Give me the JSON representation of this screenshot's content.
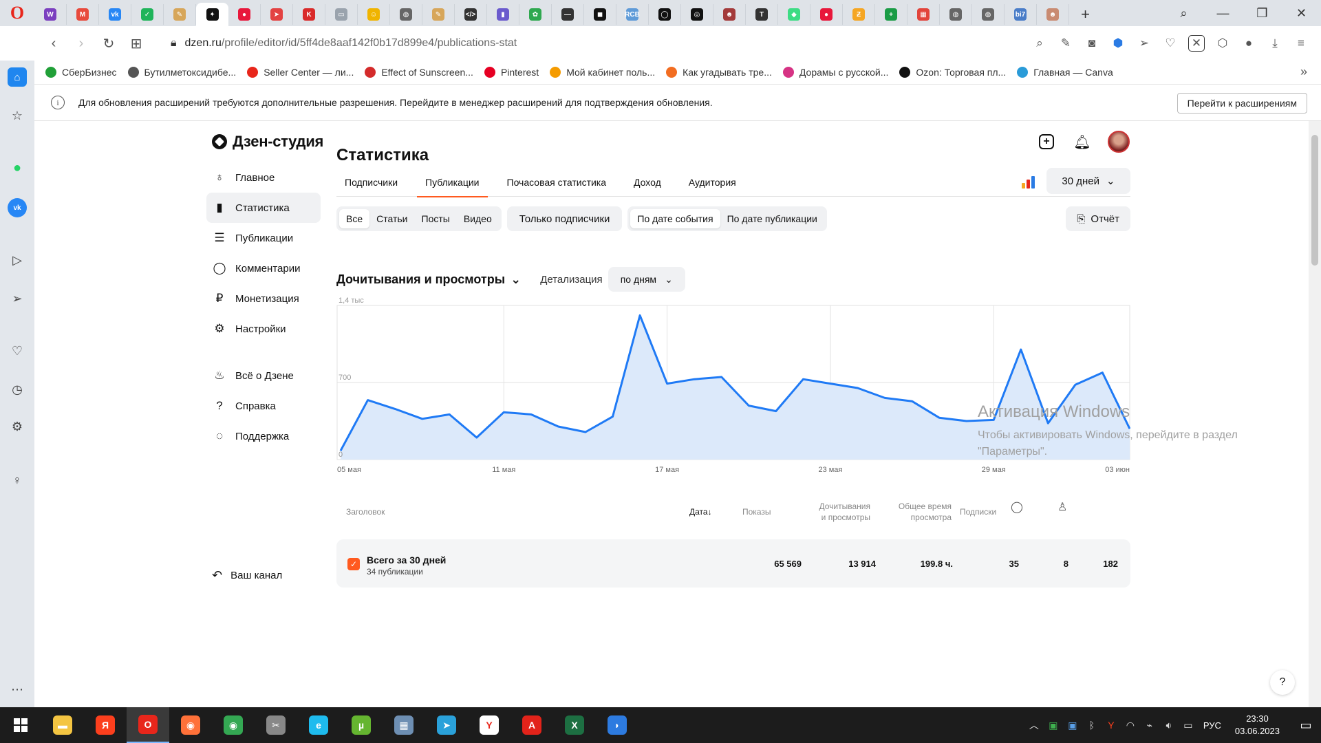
{
  "browser": {
    "logo": "O",
    "tabs": [
      {
        "icon": "word-favicon",
        "color": "#7b3fbf",
        "glyph": "W"
      },
      {
        "icon": "mail-favicon",
        "color": "#e84a3c",
        "glyph": "M"
      },
      {
        "icon": "vk-favicon",
        "color": "#2787f5",
        "glyph": "vk"
      },
      {
        "icon": "check-favicon",
        "color": "#1fb45a",
        "glyph": "✓"
      },
      {
        "icon": "feather-favicon",
        "color": "#d7a65a",
        "glyph": "✎"
      },
      {
        "icon": "dzen-favicon",
        "color": "#111111",
        "glyph": "✦",
        "active": true
      },
      {
        "icon": "red-circle-favicon",
        "color": "#e8173b",
        "glyph": "●"
      },
      {
        "icon": "red-arrow-favicon",
        "color": "#e34242",
        "glyph": "➤"
      },
      {
        "icon": "red-k-favicon",
        "color": "#d92a2a",
        "glyph": "K"
      },
      {
        "icon": "gray-box-favicon",
        "color": "#9aa3ad",
        "glyph": "▭"
      },
      {
        "icon": "yellow-face-favicon",
        "color": "#f0b400",
        "glyph": "☺"
      },
      {
        "icon": "globe-favicon",
        "color": "#666666",
        "glyph": "◍"
      },
      {
        "icon": "feather-favicon",
        "color": "#d7a65a",
        "glyph": "✎"
      },
      {
        "icon": "code-favicon",
        "color": "#333333",
        "glyph": "</>"
      },
      {
        "icon": "chart-favicon",
        "color": "#6a5acd",
        "glyph": "▮"
      },
      {
        "icon": "colorful-favicon",
        "color": "#2fa84f",
        "glyph": "✿"
      },
      {
        "icon": "pen-favicon",
        "color": "#333333",
        "glyph": "—"
      },
      {
        "icon": "black-square-favicon",
        "color": "#111111",
        "glyph": "◼"
      },
      {
        "icon": "rcb-favicon",
        "color": "#5f9bd8",
        "glyph": "RCB"
      },
      {
        "icon": "ring-favicon",
        "color": "#111111",
        "glyph": "◯"
      },
      {
        "icon": "ring-favicon",
        "color": "#111111",
        "glyph": "◎"
      },
      {
        "icon": "portrait-favicon",
        "color": "#a33a3a",
        "glyph": "☻"
      },
      {
        "icon": "t-favicon",
        "color": "#333333",
        "glyph": "T"
      },
      {
        "icon": "android-favicon",
        "color": "#3ddc84",
        "glyph": "◆"
      },
      {
        "icon": "red-dot-favicon",
        "color": "#e8173b",
        "glyph": "●"
      },
      {
        "icon": "orange-favicon",
        "color": "#f5a623",
        "glyph": "Ƶ"
      },
      {
        "icon": "plus-green-favicon",
        "color": "#1a9c46",
        "glyph": "+"
      },
      {
        "icon": "grid-favicon",
        "color": "#e2443b",
        "glyph": "▦"
      },
      {
        "icon": "globe-favicon",
        "color": "#666666",
        "glyph": "◍"
      },
      {
        "icon": "globe-favicon",
        "color": "#666666",
        "glyph": "◍"
      },
      {
        "icon": "bi7-favicon",
        "color": "#4a7dc8",
        "glyph": "bi7"
      },
      {
        "icon": "photo-favicon",
        "color": "#c98b72",
        "glyph": "☻"
      }
    ],
    "url_host": "dzen.ru",
    "url_path": "/profile/editor/id/5ff4de8aaf142f0b17d899e4/publications-stat",
    "bookmarks": [
      {
        "label": "СберБизнес",
        "color": "#21a038"
      },
      {
        "label": "Бутилметоксидибе...",
        "color": "#555555"
      },
      {
        "label": "Seller Center — ли...",
        "color": "#e8261b"
      },
      {
        "label": "Effect of Sunscreen...",
        "color": "#d42b2b"
      },
      {
        "label": "Pinterest",
        "color": "#e60023"
      },
      {
        "label": "Мой кабинет поль...",
        "color": "#f59b00"
      },
      {
        "label": "Как угадывать тре...",
        "color": "#f26d21"
      },
      {
        "label": "Дорамы с русской...",
        "color": "#d63384"
      },
      {
        "label": "Ozon: Торговая пл...",
        "color": "#111111"
      },
      {
        "label": "Главная — Canva",
        "color": "#2a9bd8"
      }
    ],
    "info_text": "Для обновления расширений требуются дополнительные разрешения. Перейдите в менеджер расширений для подтверждения обновления.",
    "info_button": "Перейти к расширениям"
  },
  "studio": {
    "logo_text": "Дзен-студия",
    "nav": [
      {
        "label": "Главное",
        "icon": "planet-icon",
        "glyph": "♁"
      },
      {
        "label": "Статистика",
        "icon": "bar-chart-icon",
        "glyph": "▮",
        "active": true
      },
      {
        "label": "Публикации",
        "icon": "stack-icon",
        "glyph": "☰"
      },
      {
        "label": "Комментарии",
        "icon": "comment-icon",
        "glyph": "◯"
      },
      {
        "label": "Монетизация",
        "icon": "ruble-icon",
        "glyph": "₽"
      },
      {
        "label": "Настройки",
        "icon": "gear-icon",
        "glyph": "⚙"
      }
    ],
    "nav2": [
      {
        "label": "Всё о Дзене",
        "icon": "flame-icon",
        "glyph": "♨"
      },
      {
        "label": "Справка",
        "icon": "question-icon",
        "glyph": "?"
      },
      {
        "label": "Поддержка",
        "icon": "support-chat-icon",
        "glyph": "◌"
      }
    ],
    "channel_label": "Ваш канал",
    "page_title": "Статистика",
    "tabs": [
      "Подписчики",
      "Публикации",
      "Почасовая статистика",
      "Доход",
      "Аудитория"
    ],
    "period": "30 дней",
    "filters_type": [
      "Все",
      "Статьи",
      "Посты",
      "Видео"
    ],
    "filter_subscribers": "Только подписчики",
    "filters_date": [
      "По дате события",
      "По дате публикации"
    ],
    "report_label": "Отчёт",
    "metric_title": "Дочитывания и просмотры",
    "detail_label": "Детализация",
    "detail_value": "по дням"
  },
  "chart_data": {
    "type": "area",
    "y_tick_labels": [
      "0",
      "700",
      "1,4 тыс"
    ],
    "ylim": [
      0,
      1400
    ],
    "x_tick_labels": [
      "05 мая",
      "11 мая",
      "17 мая",
      "23 мая",
      "29 мая",
      "03 июн"
    ],
    "x": [
      "05 мая",
      "06 мая",
      "07 мая",
      "08 мая",
      "09 мая",
      "10 мая",
      "11 мая",
      "12 мая",
      "13 мая",
      "14 мая",
      "15 мая",
      "16 мая",
      "17 мая",
      "18 мая",
      "19 мая",
      "20 мая",
      "21 мая",
      "22 мая",
      "23 мая",
      "24 мая",
      "25 мая",
      "26 мая",
      "27 мая",
      "28 мая",
      "29 мая",
      "30 мая",
      "31 мая",
      "01 июн",
      "02 июн",
      "03 июн"
    ],
    "values": [
      80,
      540,
      460,
      370,
      410,
      200,
      430,
      410,
      300,
      250,
      390,
      1310,
      690,
      730,
      750,
      490,
      440,
      730,
      690,
      650,
      560,
      530,
      380,
      350,
      360,
      1000,
      330,
      680,
      790,
      280
    ],
    "colors": {
      "line": "#1f7af5",
      "fill": "#dce9fa"
    },
    "grid": true
  },
  "table": {
    "headers": {
      "title": "Заголовок",
      "date": "Дата",
      "date_sort": "↓",
      "shows": "Показы",
      "reads_1": "Дочитывания",
      "reads_2": "и просмотры",
      "time_1": "Общее время",
      "time_2": "просмотра",
      "subs": "Подписки",
      "comments_icon": "comment-icon",
      "likes_icon": "like-icon"
    },
    "total": {
      "title": "Всего за 30 дней",
      "subtitle": "34 публикации",
      "shows": "65 569",
      "reads": "13 914",
      "time": "199.8 ч.",
      "subs": "35",
      "comments": "8",
      "likes": "182"
    }
  },
  "windows_watermark": {
    "title": "Активация Windows",
    "text": "Чтобы активировать Windows, перейдите в раздел \"Параметры\"."
  },
  "taskbar": {
    "apps": [
      {
        "icon": "explorer-icon",
        "color": "#f4c542",
        "glyph": "▬"
      },
      {
        "icon": "yandex-icon",
        "color": "#fc3f1d",
        "glyph": "Я"
      },
      {
        "icon": "opera-icon",
        "color": "#e8261b",
        "glyph": "O",
        "active": true
      },
      {
        "icon": "firefox-icon",
        "color": "#ff7139",
        "glyph": "◉"
      },
      {
        "icon": "chrome-icon",
        "color": "#34a853",
        "glyph": "◉"
      },
      {
        "icon": "tool-icon",
        "color": "#888888",
        "glyph": "✂"
      },
      {
        "icon": "ie-icon",
        "color": "#1ebbee",
        "glyph": "e"
      },
      {
        "icon": "utorrent-icon",
        "color": "#65b530",
        "glyph": "µ"
      },
      {
        "icon": "calculator-icon",
        "color": "#6e8fb3",
        "glyph": "▦"
      },
      {
        "icon": "telegram-icon",
        "color": "#2aa1da",
        "glyph": "➤"
      },
      {
        "icon": "yandex-browser-icon",
        "color": "#ffffff",
        "glyph": "Y"
      },
      {
        "icon": "pdf-icon",
        "color": "#e2231a",
        "glyph": "A"
      },
      {
        "icon": "excel-icon",
        "color": "#1d6f42",
        "glyph": "X"
      },
      {
        "icon": "app-icon",
        "color": "#2d7be0",
        "glyph": "◗"
      }
    ],
    "lang": "РУС",
    "time": "23:30",
    "date": "03.06.2023"
  }
}
